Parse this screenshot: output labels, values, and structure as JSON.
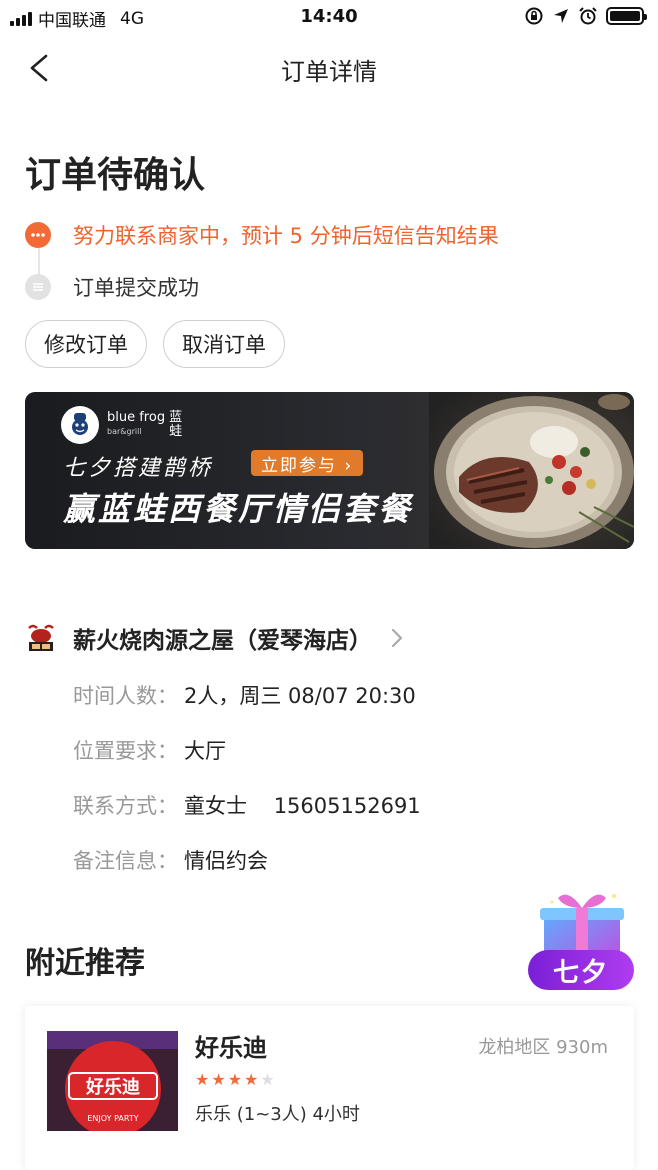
{
  "status_bar": {
    "carrier": "中国联通",
    "network": "4G",
    "time": "14:40"
  },
  "nav": {
    "title": "订单详情"
  },
  "order": {
    "status_title": "订单待确认",
    "timeline": [
      {
        "text": "努力联系商家中，预计 5 分钟后短信告知结果",
        "state": "active"
      },
      {
        "text": "订单提交成功",
        "state": "past"
      }
    ],
    "actions": {
      "modify_label": "修改订单",
      "cancel_label": "取消订单"
    }
  },
  "banner": {
    "brand_en": "blue frog",
    "brand_cn": "蓝蛙",
    "brand_sub": "bar&grill",
    "line1": "七夕搭建鹊桥",
    "cta": "立即参与 ›",
    "line2": "赢蓝蛙西餐厅情侣套餐"
  },
  "restaurant": {
    "name": "薪火烧肉源之屋（爱琴海店）",
    "details": [
      {
        "label": "时间人数",
        "value": "2人，周三 08/07 20:30"
      },
      {
        "label": "位置要求",
        "value": "大厅"
      },
      {
        "label": "联系方式",
        "value": "童女士    15605152691"
      },
      {
        "label": "备注信息",
        "value": "情侣约会"
      }
    ]
  },
  "nearby": {
    "title": "附近推荐",
    "badge": "七夕",
    "items": [
      {
        "name": "好乐迪",
        "area": "龙柏地区 930m",
        "rating": 4,
        "max_rating": 5,
        "desc": "乐乐 (1~3人) 4小时",
        "logo_text": "好乐迪",
        "logo_sub": "ENJOY PARTY"
      }
    ]
  },
  "colors": {
    "accent": "#f0622e",
    "muted": "#999999",
    "qixi_purple": "#8a2be2"
  }
}
